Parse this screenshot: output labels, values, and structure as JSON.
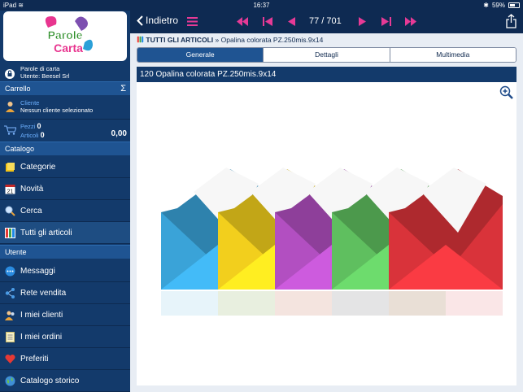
{
  "status": {
    "device": "iPad",
    "time": "16:37",
    "battery": "59%",
    "battery_level": 0.59
  },
  "sidebar": {
    "logo_text": "Parole di Carta",
    "user_company": "Parole di carta",
    "user_line": "Utente: Beesel Srl",
    "cart_header": "Carrello",
    "cart_sigma": "Σ",
    "client_label": "Cliente",
    "client_value": "Nessun cliente selezionato",
    "pezzi_label": "Pezzi",
    "pezzi_value": "0",
    "articoli_label": "Articoli",
    "articoli_value": "0",
    "total": "0,00",
    "catalog_header": "Catalogo",
    "catalog_items": [
      {
        "label": "Categorie",
        "icon": "folder-icon"
      },
      {
        "label": "Novità",
        "icon": "calendar-icon"
      },
      {
        "label": "Cerca",
        "icon": "search-icon"
      },
      {
        "label": "Tutti gli articoli",
        "icon": "grid-icon"
      }
    ],
    "user_header": "Utente",
    "user_items": [
      {
        "label": "Messaggi",
        "icon": "chat-icon"
      },
      {
        "label": "Rete vendita",
        "icon": "share-icon"
      },
      {
        "label": "I miei clienti",
        "icon": "clients-icon"
      },
      {
        "label": "I miei ordini",
        "icon": "orders-icon"
      },
      {
        "label": "Preferiti",
        "icon": "heart-icon"
      },
      {
        "label": "Catalogo storico",
        "icon": "globe-icon"
      }
    ]
  },
  "toolbar": {
    "back_label": "Indietro",
    "counter": "77 / 701"
  },
  "breadcrumb": {
    "root": "TUTTI GLI ARTICOLI",
    "separator": "»",
    "current": "Opalina colorata PZ.250mis.9x14"
  },
  "tabs": [
    "Generale",
    "Dettagli",
    "Multimedia"
  ],
  "product": {
    "title": "120 Opalina colorata PZ.250mis.9x14"
  },
  "colors": {
    "envelopes": [
      "#3aa3d8",
      "#f2cf1d",
      "#b24fc1",
      "#5fbf5f",
      "#d9333a"
    ]
  }
}
